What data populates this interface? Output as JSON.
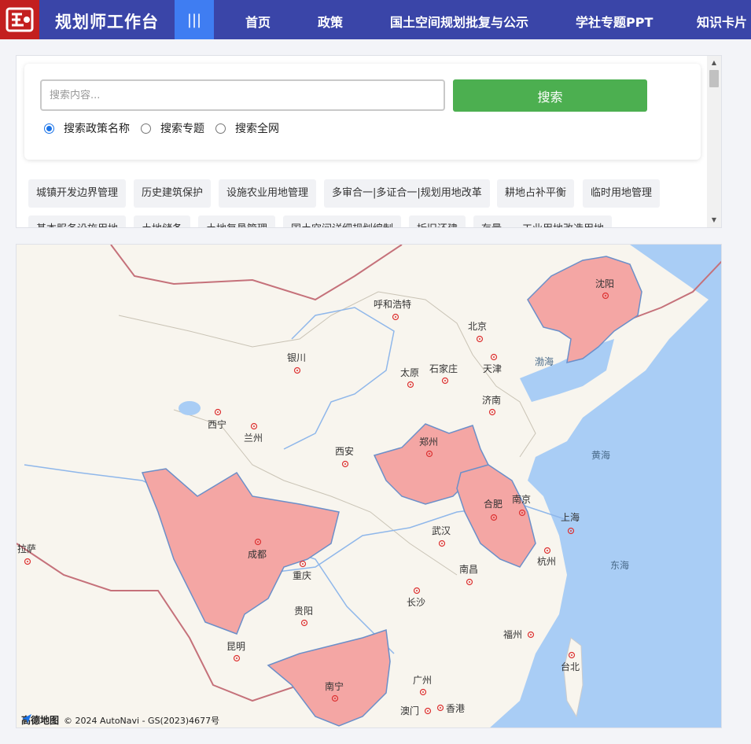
{
  "header": {
    "brand": "规划师工作台",
    "menu_glyph": "|||",
    "nav": [
      "首页",
      "政策",
      "国土空间规划批复与公示",
      "学社专题PPT",
      "知识卡片"
    ]
  },
  "search": {
    "placeholder": "搜索内容...",
    "value": "",
    "button": "搜索",
    "options": [
      {
        "label": "搜索政策名称",
        "checked": true
      },
      {
        "label": "搜索专题",
        "checked": false
      },
      {
        "label": "搜索全网",
        "checked": false
      }
    ]
  },
  "tags": [
    "城镇开发边界管理",
    "历史建筑保护",
    "设施农业用地管理",
    "多审合一|多证合一|规划用地改革",
    "耕地占补平衡",
    "临时用地管理",
    "基本服务设施用地",
    "土地储备",
    "土地复垦管理",
    "国土空间详细规划编制",
    "拆旧还建",
    "存量——工业用地改造用地"
  ],
  "map": {
    "cities": [
      "呼和浩特",
      "北京",
      "天津",
      "石家庄",
      "太原",
      "银川",
      "西宁",
      "兰州",
      "济南",
      "郑州",
      "西安",
      "沈阳",
      "合肥",
      "南京",
      "上海",
      "杭州",
      "武汉",
      "成都",
      "重庆",
      "拉萨",
      "长沙",
      "南昌",
      "贵阳",
      "昆明",
      "福州",
      "台北",
      "南宁",
      "广州",
      "香港",
      "澳门"
    ],
    "seas": [
      "渤海",
      "黄海",
      "东海"
    ],
    "highlight_color": "#f4a6a4",
    "brand": "高德地图",
    "copyright": "© 2024 AutoNavi - GS(2023)4677号"
  }
}
